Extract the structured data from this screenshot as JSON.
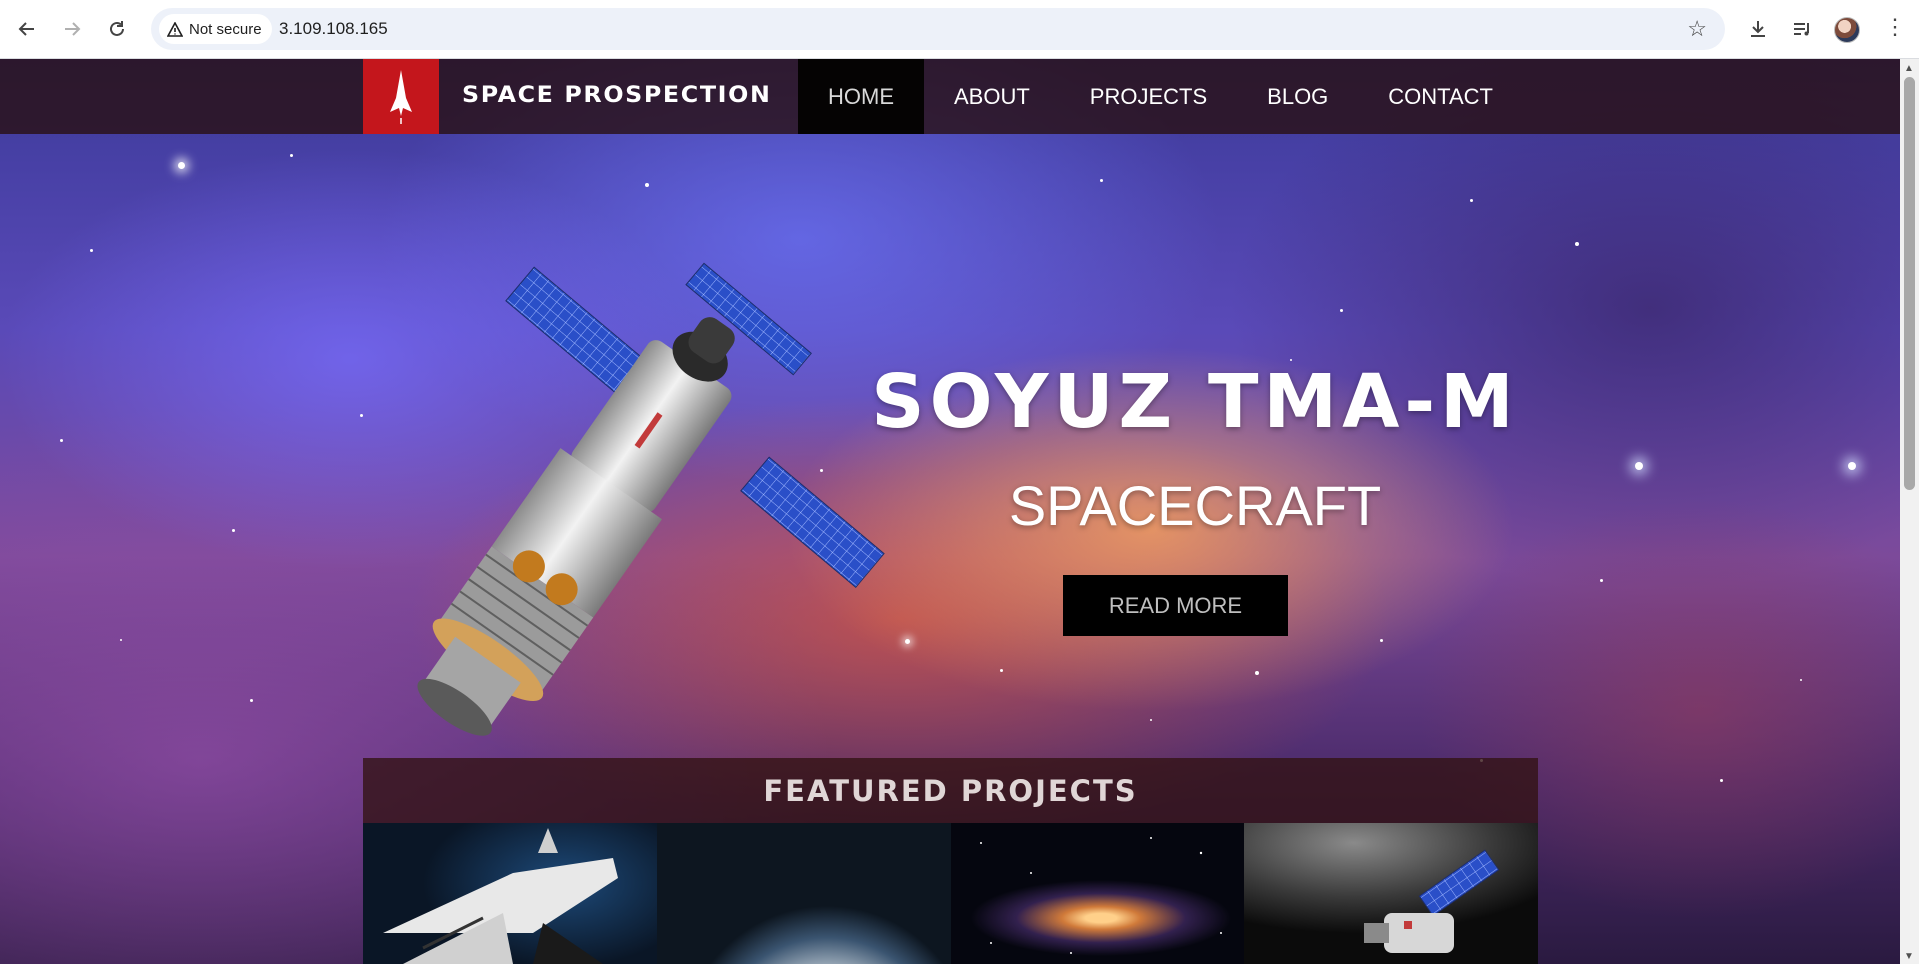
{
  "browser": {
    "security_label": "Not secure",
    "url": "3.109.108.165"
  },
  "site": {
    "brand": "SPACE PROSPECTION",
    "menu": [
      {
        "label": "HOME",
        "active": true
      },
      {
        "label": "ABOUT",
        "active": false
      },
      {
        "label": "PROJECTS",
        "active": false
      },
      {
        "label": "BLOG",
        "active": false
      },
      {
        "label": "CONTACT",
        "active": false
      }
    ],
    "accent_color": "#c4161c"
  },
  "hero": {
    "title": "SOYUZ TMA-M",
    "subtitle": "SPACECRAFT",
    "button_label": "READ MORE"
  },
  "featured": {
    "title": "FEATURED PROJECTS",
    "thumbnails": [
      "space-shuttle-image",
      "earth-horizon-image",
      "galaxy-image",
      "lunar-station-image"
    ]
  }
}
